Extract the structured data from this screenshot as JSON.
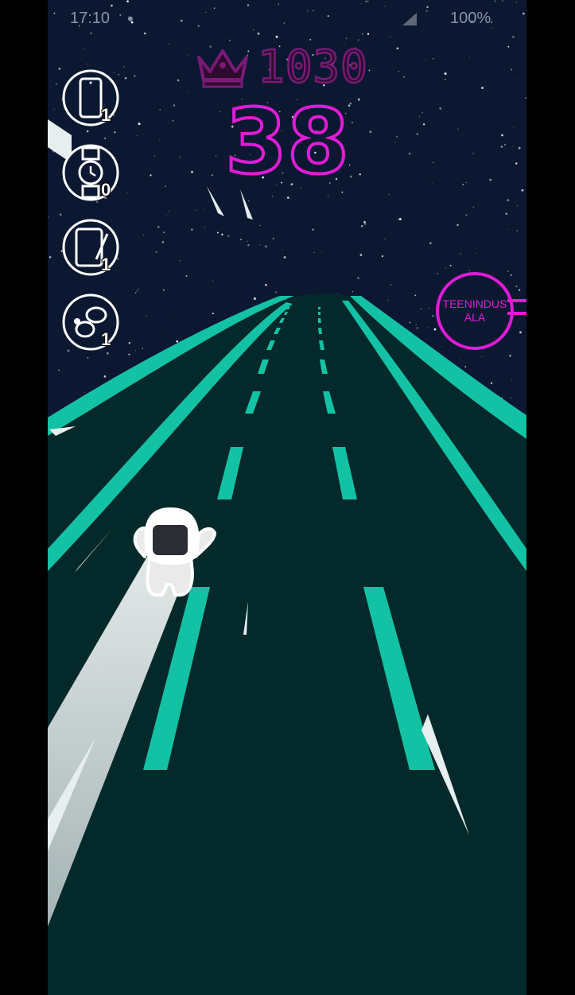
{
  "status_bar": {
    "time": "17:10",
    "battery": "100%"
  },
  "hud": {
    "best_icon": "crown-icon",
    "best_score": "1030",
    "current_score": "38"
  },
  "collected_items": [
    {
      "icon": "phone-icon",
      "count": "1"
    },
    {
      "icon": "smartwatch-icon",
      "count": "0"
    },
    {
      "icon": "tablet-icon",
      "count": "1"
    },
    {
      "icon": "earbuds-icon",
      "count": "1"
    }
  ],
  "target": {
    "line1": "TEENINDUS",
    "line2": "ALA"
  },
  "colors": {
    "accent": "#e21bd8",
    "road": "#03292a",
    "lane_markings": "#13c2a5",
    "sky": "#0c1832"
  }
}
